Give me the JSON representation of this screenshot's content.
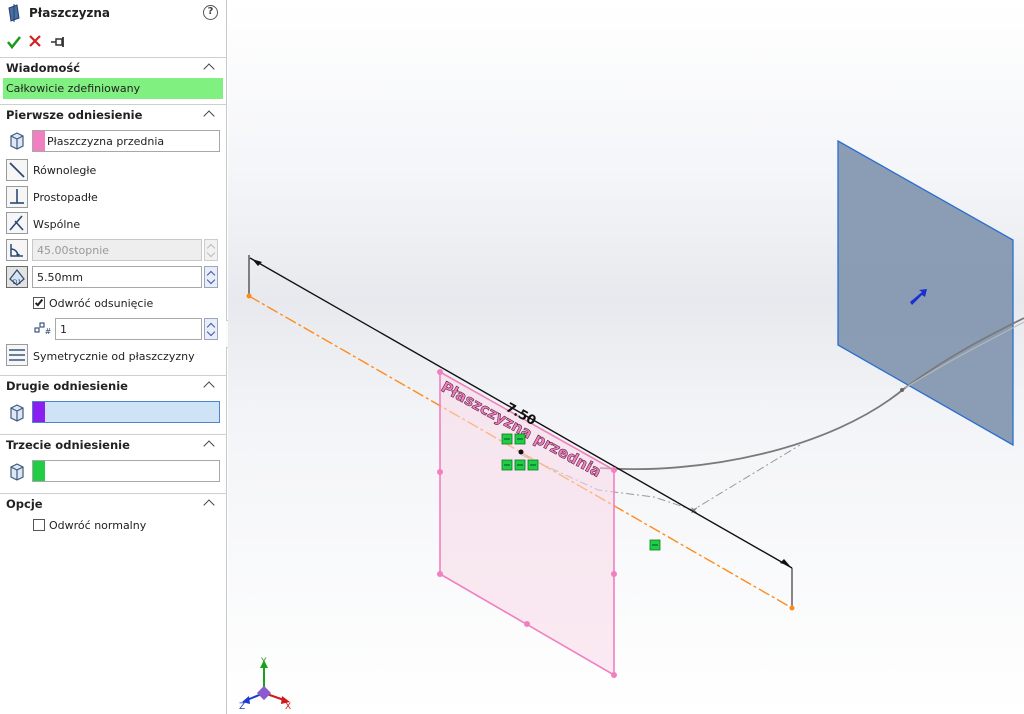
{
  "panel": {
    "title": "Płaszczyzna",
    "help_glyph": "?",
    "actions": {
      "ok_icon": "check-icon",
      "cancel_icon": "close-icon",
      "pin_icon": "pushpin-icon"
    },
    "message": {
      "header": "Wiadomość",
      "text": "Całkowicie zdefiniowany",
      "color": "#80f080"
    },
    "first_reference": {
      "header": "Pierwsze odniesienie",
      "selection": "Płaszczyzna przednia",
      "selection_color": "#f080c0",
      "options": {
        "parallel": "Równoległe",
        "perpendicular": "Prostopadłe",
        "coincident": "Wspólne",
        "angle_value": "45.00stopnie",
        "offset_value": "5.50mm",
        "flip_offset_label": "Odwróć odsunięcie",
        "flip_offset_checked": true,
        "instances_value": "1",
        "mid_plane": "Symetrycznie od płaszczyzny"
      }
    },
    "second_reference": {
      "header": "Drugie odniesienie",
      "selection_color": "#8a1ff0"
    },
    "third_reference": {
      "header": "Trzecie odniesienie",
      "selection_color": "#22cc44"
    },
    "options": {
      "header": "Opcje",
      "flip_normal_label": "Odwróć normalny",
      "flip_normal_checked": false
    }
  },
  "viewport": {
    "dimension_value": "7.50",
    "plane_label": "Płaszczyzna przednia",
    "triad": {
      "x": "X",
      "y": "Y",
      "z": "Z"
    },
    "colors": {
      "preview_plane": "#f080c0",
      "offset_line": "#ff8c1a",
      "solid_plane": "#7f93ad",
      "relation_marker": "#22cc44"
    }
  }
}
